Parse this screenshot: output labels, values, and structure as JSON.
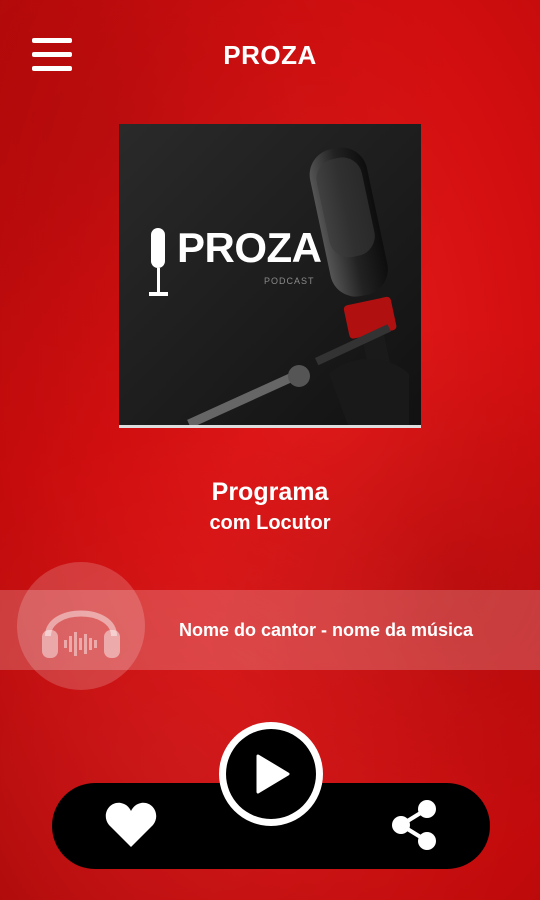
{
  "header": {
    "title": "PROZA",
    "menu_icon": "hamburger-menu-icon"
  },
  "cover": {
    "brand_word": "PROZA",
    "brand_sub": "PODCAST",
    "mic_label": "PODCAST"
  },
  "program": {
    "title": "Programa",
    "host": "com Locutor"
  },
  "now_playing": {
    "text": "Nome do cantor - nome da música",
    "icon": "headphones-icon"
  },
  "controls": {
    "favorite_icon": "heart-icon",
    "play_icon": "play-icon",
    "share_icon": "share-icon"
  },
  "colors": {
    "background": "#d40f10",
    "control_bar": "#000000",
    "text": "#ffffff"
  }
}
